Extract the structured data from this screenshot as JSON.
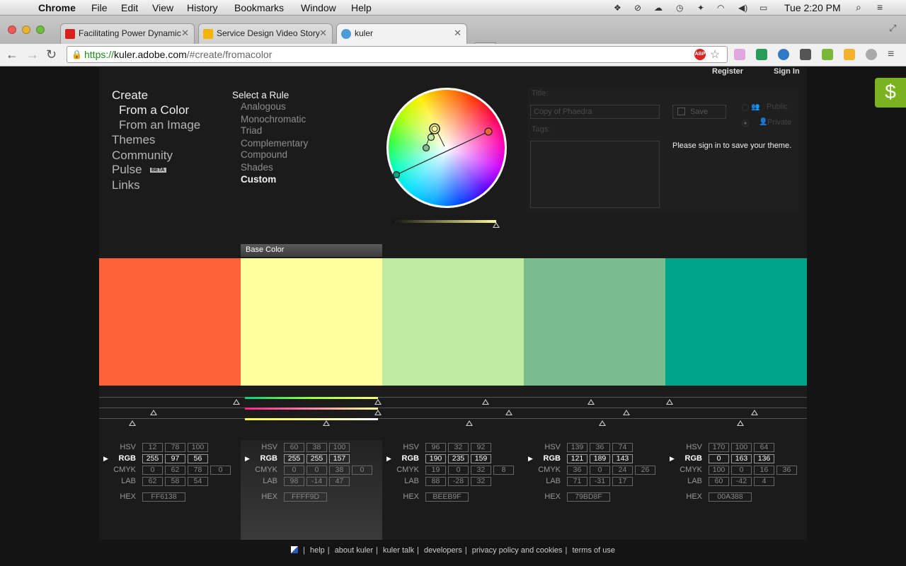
{
  "menubar": {
    "app": "Chrome",
    "items": [
      "File",
      "Edit",
      "View",
      "History",
      "Bookmarks",
      "Window",
      "Help"
    ],
    "clock": "Tue 2:20 PM"
  },
  "browser": {
    "tabs": [
      {
        "title": "Facilitating Power Dynamic",
        "favicon_color": "#d8211c"
      },
      {
        "title": "Service Design Video Story",
        "favicon_color": "#f5b400"
      },
      {
        "title": "kuler",
        "favicon_color": "#4a9bd6"
      }
    ],
    "url_scheme": "https://",
    "url_host": "kuler.adobe.com",
    "url_path": "/#create/fromacolor"
  },
  "header": {
    "register": "Register",
    "sign_in": "Sign In"
  },
  "side_extension": {
    "glyph": "$",
    "color": "#7ab31f"
  },
  "nav": {
    "create": "Create",
    "from_color": "From a Color",
    "from_image": "From an Image",
    "themes": "Themes",
    "community": "Community",
    "pulse": "Pulse",
    "pulse_badge": "BETA",
    "links": "Links"
  },
  "rules": {
    "heading": "Select a Rule",
    "items": [
      "Analogous",
      "Monochromatic",
      "Triad",
      "Complementary",
      "Compound",
      "Shades",
      "Custom"
    ],
    "selected": "Custom"
  },
  "save_panel": {
    "title_label": "Title:",
    "title_value": "Copy of Phaedra",
    "tags_label": "Tags:",
    "save_label": "Save",
    "public_label": "Public",
    "private_label": "Private",
    "signin_msg": "Please sign in to save your theme."
  },
  "base_color_label": "Base Color",
  "swatches": [
    {
      "hex": "FF6138",
      "color": "#FF6138",
      "hsv": [
        "12",
        "78",
        "100"
      ],
      "rgb": [
        "255",
        "97",
        "56"
      ],
      "cmyk": [
        "0",
        "62",
        "78",
        "0"
      ],
      "lab": [
        "62",
        "58",
        "54"
      ]
    },
    {
      "hex": "FFFF9D",
      "color": "#FFFF9D",
      "hsv": [
        "60",
        "38",
        "100"
      ],
      "rgb": [
        "255",
        "255",
        "157"
      ],
      "cmyk": [
        "0",
        "0",
        "38",
        "0"
      ],
      "lab": [
        "98",
        "-14",
        "47"
      ]
    },
    {
      "hex": "BEEB9F",
      "color": "#BEEB9F",
      "hsv": [
        "96",
        "32",
        "92"
      ],
      "rgb": [
        "190",
        "235",
        "159"
      ],
      "cmyk": [
        "19",
        "0",
        "32",
        "8"
      ],
      "lab": [
        "88",
        "-28",
        "32"
      ]
    },
    {
      "hex": "79BD8F",
      "color": "#79BD8F",
      "hsv": [
        "139",
        "36",
        "74"
      ],
      "rgb": [
        "121",
        "189",
        "143"
      ],
      "cmyk": [
        "36",
        "0",
        "24",
        "26"
      ],
      "lab": [
        "71",
        "-31",
        "17"
      ]
    },
    {
      "hex": "00A388",
      "color": "#00A388",
      "hsv": [
        "170",
        "100",
        "64"
      ],
      "rgb": [
        "0",
        "163",
        "136"
      ],
      "cmyk": [
        "100",
        "0",
        "16",
        "36"
      ],
      "lab": [
        "60",
        "-42",
        "4"
      ]
    }
  ],
  "labels": {
    "hsv": "HSV",
    "rgb": "RGB",
    "cmyk": "CMYK",
    "lab": "LAB",
    "hex": "HEX"
  },
  "footer": {
    "links": [
      "help",
      "about kuler",
      "kuler talk",
      "developers",
      "privacy policy and cookies",
      "terms of use"
    ]
  }
}
